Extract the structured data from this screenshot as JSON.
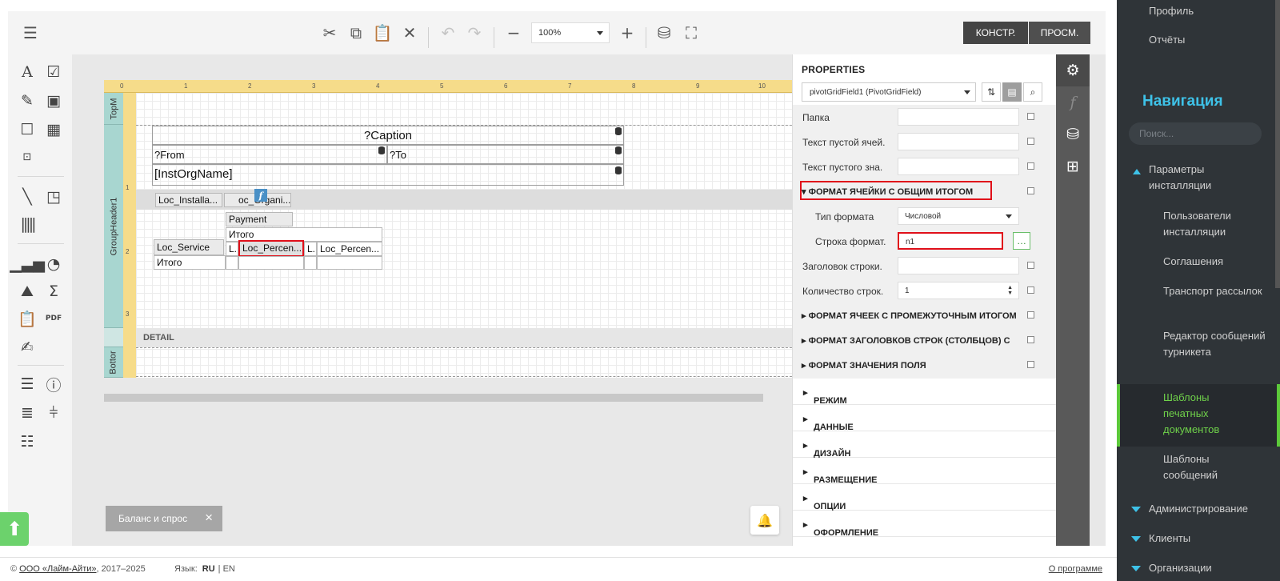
{
  "toolbar": {
    "zoom": "100%",
    "design_label": "КОНСТР.",
    "preview_label": "ПРОСМ."
  },
  "toolbox_icons": [
    "text-icon",
    "checkbox-icon",
    "rich-text-icon",
    "picture-icon",
    "panel-icon",
    "table-icon",
    "label-icon",
    "line-icon",
    "shape-icon",
    "barcode-icon",
    "chart-icon",
    "gauge-icon",
    "sparkline-icon",
    "summary-icon",
    "clipboard-icon",
    "pdf-icon",
    "signature-icon",
    "toc-icon",
    "info-icon",
    "page-break-icon",
    "cross-band-icon",
    "subreport-icon"
  ],
  "report": {
    "ruler_ticks": [
      "0",
      "1",
      "2",
      "3",
      "4",
      "5",
      "6",
      "7",
      "8",
      "9",
      "10"
    ],
    "left_ticks": [
      "1",
      "2",
      "3"
    ],
    "bands": {
      "top_margin": "TopM",
      "group_header": "GroupHeader1",
      "detail": "DETAIL",
      "bottom_margin": "Bottor"
    },
    "caption": "?Caption",
    "from": "?From",
    "to": "?To",
    "inst_org_name": "[InstOrgName]",
    "pivot": {
      "filter_loc_installation": "Loc_Installa...",
      "filter_loc_org": "oc_Organi...",
      "column_header_payment": "Payment",
      "column_total": "Итого",
      "row_loc_service": "Loc_Service",
      "l1": "L..",
      "loc_percent_1": "Loc_Percen...",
      "l2": "L..",
      "loc_percent_2": "Loc_Percen...",
      "row_total": "Итого"
    }
  },
  "floating_chip": {
    "label": "Баланс и спрос",
    "close": "×"
  },
  "properties": {
    "title": "PROPERTIES",
    "object": "pivotGridField1 (PivotGridField)",
    "rows": [
      {
        "label": "Папка",
        "value": ""
      },
      {
        "label": "Текст пустой ячей.",
        "value": ""
      },
      {
        "label": "Текст пустого зна.",
        "value": ""
      }
    ],
    "group_total_format": "ФОРМАТ ЯЧЕЙКИ С ОБЩИМ ИТОГОМ",
    "format_type_label": "Тип формата",
    "format_type_value": "Числовой",
    "format_string_label": "Строка формат.",
    "format_string_value": "n1",
    "row_header_label": "Заголовок строки.",
    "row_count_label": "Количество строк.",
    "row_count_value": "1",
    "group_intermediate": "ФОРМАТ ЯЧЕЕК С ПРОМЕЖУТОЧНЫМ ИТОГОМ",
    "group_headers": "ФОРМАТ ЗАГОЛОВКОВ СТРОК (СТОЛБЦОВ) С",
    "group_field_value": "ФОРМАТ ЗНАЧЕНИЯ ПОЛЯ",
    "sections": [
      "РЕЖИМ",
      "ДАННЫЕ",
      "ДИЗАЙН",
      "РАЗМЕЩЕНИЕ",
      "ОПЦИИ",
      "ОФОРМЛЕНИЕ"
    ]
  },
  "nav": {
    "profile": "Профиль",
    "reports": "Отчёты",
    "title": "Навигация",
    "search_placeholder": "Поиск...",
    "install_params": "Параметры инсталляции",
    "items": [
      "Пользователи инсталляции",
      "Соглашения",
      "Транспорт рассылок",
      "Редактор сообщений турникета",
      "Шаблоны печатных документов",
      "Шаблоны сообщений"
    ],
    "administration": "Администрирование",
    "clients": "Клиенты",
    "organizations": "Организации"
  },
  "footer": {
    "copyright_prefix": "©",
    "company": "ООО «Лайм-Айти»",
    "years": ", 2017–2025",
    "lang_label": "Язык:",
    "lang_ru": "RU",
    "lang_sep": "|",
    "lang_en": "EN",
    "about": "О программе"
  }
}
